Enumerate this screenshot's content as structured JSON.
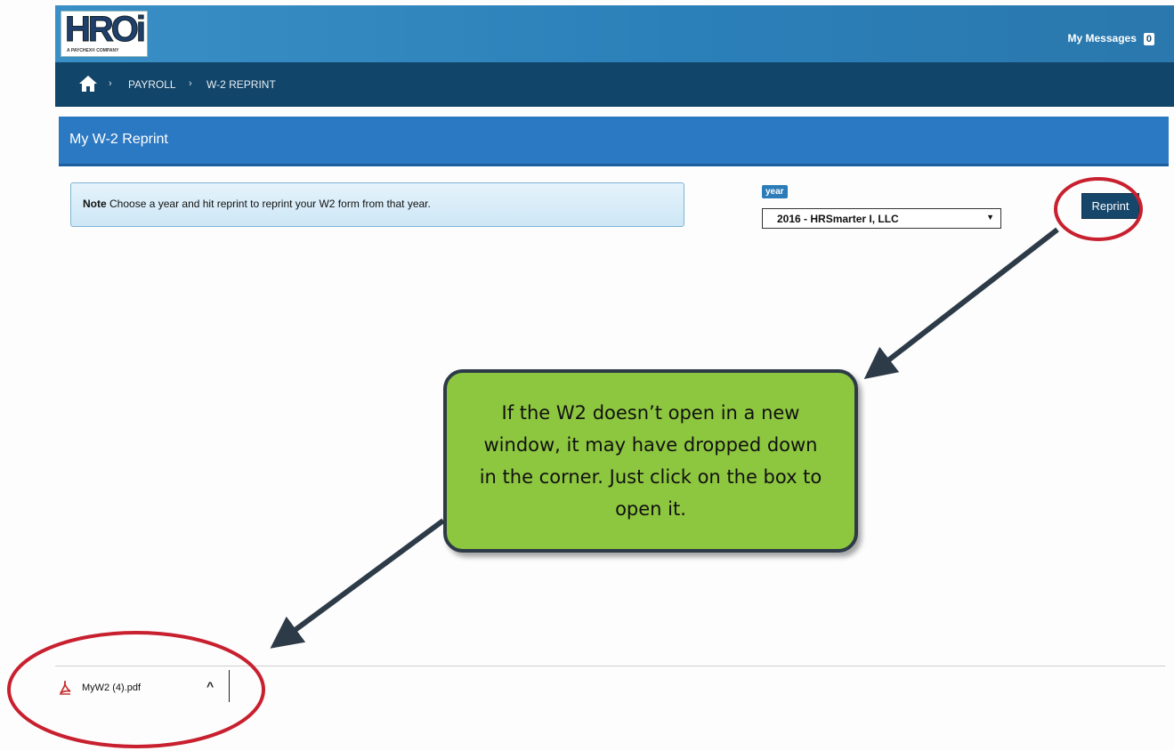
{
  "header": {
    "logo_text": "HROi",
    "logo_subtitle": "A PAYCHEX® COMPANY",
    "messages_label": "My Messages",
    "messages_count": "0"
  },
  "breadcrumb": {
    "home_icon": "home-icon",
    "items": [
      "PAYROLL",
      "W-2 REPRINT"
    ]
  },
  "page": {
    "title": "My W-2 Reprint"
  },
  "note": {
    "label": "Note",
    "text": "Choose a year and hit reprint to reprint your W2 form from that year."
  },
  "year_select": {
    "label": "year",
    "selected": "2016 - HRSmarter I, LLC"
  },
  "reprint_button": "Reprint",
  "callout": {
    "text": "If the W2 doesn’t open in a new window, it may have dropped down in the corner.  Just click on the box to open it."
  },
  "download_bar": {
    "file_name": "MyW2 (4).pdf",
    "file_icon": "pdf-icon",
    "menu_caret": "^"
  },
  "colors": {
    "header_blue": "#2b7fb8",
    "nav_dark": "#12456a",
    "title_blue": "#2c79c3",
    "callout_green": "#8dc63f",
    "annotation_red": "#c8202f",
    "arrow_dark": "#2d3b48"
  }
}
